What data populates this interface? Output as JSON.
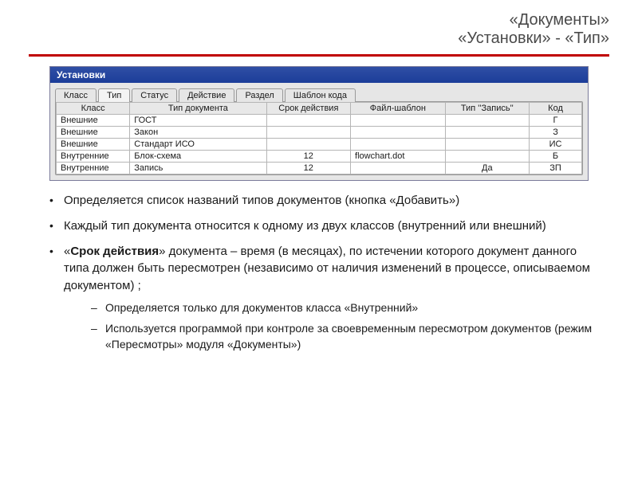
{
  "title": {
    "line1": "«Документы»",
    "line2": "«Установки» - «Тип»"
  },
  "window": {
    "caption": "Установки",
    "tabs": [
      "Класс",
      "Тип",
      "Статус",
      "Действие",
      "Раздел",
      "Шаблон кода"
    ],
    "active_tab_index": 1,
    "columns": [
      "Класс",
      "Тип документа",
      "Срок действия",
      "Файл-шаблон",
      "Тип ''Запись''",
      "Код"
    ],
    "rows": [
      {
        "klass": "Внешние",
        "doc_type": "ГОСТ",
        "term": "",
        "file": "",
        "rec": "",
        "code": "Г"
      },
      {
        "klass": "Внешние",
        "doc_type": "Закон",
        "term": "",
        "file": "",
        "rec": "",
        "code": "З"
      },
      {
        "klass": "Внешние",
        "doc_type": "Стандарт ИСО",
        "term": "",
        "file": "",
        "rec": "",
        "code": "ИС"
      },
      {
        "klass": "Внутренние",
        "doc_type": "Блок-схема",
        "term": "12",
        "file": "flowchart.dot",
        "rec": "",
        "code": "Б"
      },
      {
        "klass": "Внутренние",
        "doc_type": "Запись",
        "term": "12",
        "file": "",
        "rec": "Да",
        "code": "ЗП"
      }
    ]
  },
  "bullets": {
    "b1": "Определяется список названий типов документов (кнопка «Добавить»)",
    "b2": "Каждый тип документа относится к одному из двух классов (внутренний или внешний)",
    "b3_pre": "«",
    "b3_bold": "Срок действия",
    "b3_post": "» документа – время (в месяцах), по истечении которого документ данного типа должен быть пересмотрен (независимо от наличия изменений в процессе, описываемом документом) ;",
    "b3_s1": "Определяется только для документов класса «Внутренний»",
    "b3_s2": "Используется программой при контроле за своевременным пересмотром документов (режим «Пересмотры» модуля «Документы»)"
  }
}
